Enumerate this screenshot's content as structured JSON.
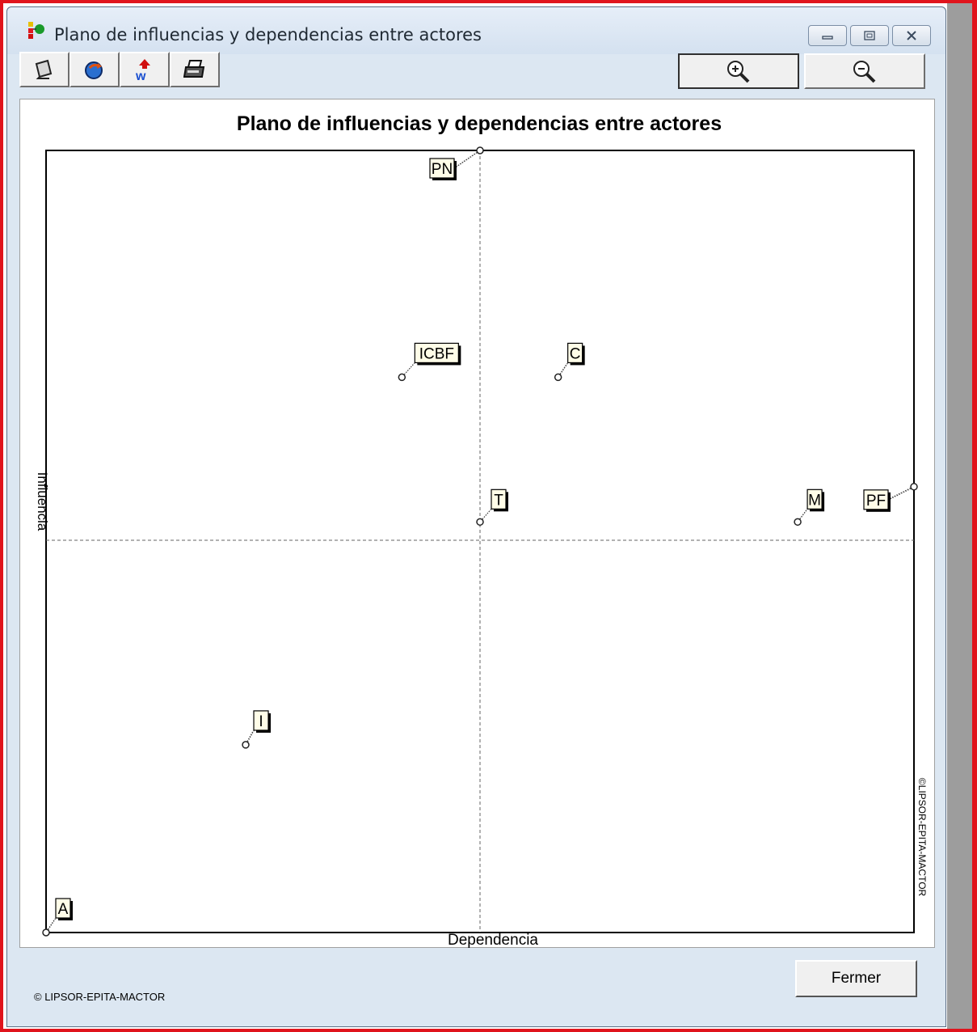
{
  "window": {
    "title": "Plano de influencias y dependencias entre actores",
    "caption_buttons": [
      "minimize-icon",
      "maximize-icon",
      "close-icon"
    ]
  },
  "toolbar": {
    "icons": [
      "copy-icon",
      "refresh-icon",
      "export-word-icon",
      "print-icon"
    ],
    "zoom_in_icon": "zoom-in-icon",
    "zoom_out_icon": "zoom-out-icon"
  },
  "chart_data": {
    "type": "scatter",
    "title": "Plano de influencias y dependencias entre actores",
    "xlabel": "Dependencia",
    "ylabel": "Influencia",
    "watermark": "©LIPSOR-EPITA-MACTOR",
    "grid": false,
    "quadrant_lines": true,
    "points": [
      {
        "label": "PN",
        "x": 0.5,
        "y": 1.0
      },
      {
        "label": "ICBF",
        "x": 0.41,
        "y": 0.71
      },
      {
        "label": "C",
        "x": 0.59,
        "y": 0.71
      },
      {
        "label": "T",
        "x": 0.5,
        "y": 0.525
      },
      {
        "label": "M",
        "x": 0.866,
        "y": 0.525
      },
      {
        "label": "PF",
        "x": 1.0,
        "y": 0.57
      },
      {
        "label": "I",
        "x": 0.23,
        "y": 0.24
      },
      {
        "label": "A",
        "x": 0.0,
        "y": 0.0
      }
    ]
  },
  "footer": {
    "copyright": "© LIPSOR-EPITA-MACTOR",
    "close_button": "Fermer"
  }
}
